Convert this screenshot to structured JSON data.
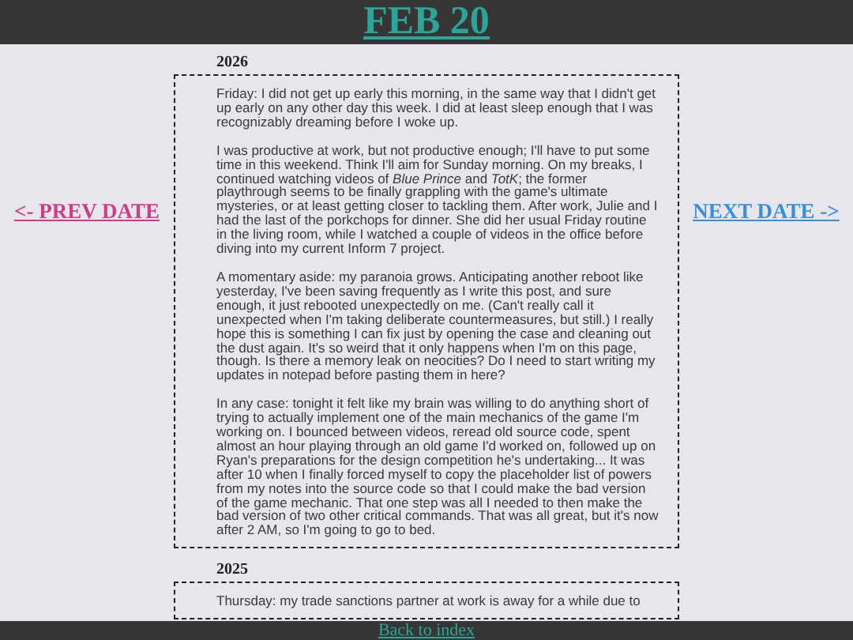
{
  "header": {
    "title": "FEB 20"
  },
  "nav": {
    "prev": "<- PREV DATE",
    "next": "NEXT DATE ->"
  },
  "entries": [
    {
      "year": "2026",
      "paragraphs": [
        "Friday: I did not get up early this morning, in the same way that I didn't get up early on any other day this week. I did at least sleep enough that I was recognizably dreaming before I woke up.",
        "I was productive at work, but not productive enough; I'll have to put some time in this weekend. Think I'll aim for Sunday morning. On my breaks, I continued watching videos of *Blue Prince* and *TotK*; the former playthrough seems to be finally grappling with the game's ultimate mysteries, or at least getting closer to tackling them. After work, Julie and I had the last of the porkchops for dinner. She did her usual Friday routine in the living room, while I watched a couple of videos in the office before diving into my current Inform 7 project.",
        "A momentary aside: my paranoia grows. Anticipating another reboot like yesterday, I've been saving frequently as I write this post, and sure enough, it just rebooted unexpectedly on me. (Can't really call it unexpected when I'm taking deliberate countermeasures, but still.) I really hope this is something I can fix just by opening the case and cleaning out the dust again. It's so weird that it only happens when I'm on this page, though. Is there a memory leak on neocities? Do I need to start writing my updates in notepad before pasting them in here?",
        "In any case: tonight it felt like my brain was willing to do anything short of trying to actually implement one of the main mechanics of the game I'm working on. I bounced between videos, reread old source code, spent almost an hour playing through an old game I'd worked on, followed up on Ryan's preparations for the design competition he's undertaking... It was after 10 when I finally forced myself to copy the placeholder list of powers from my notes into the source code so that I could make the bad version of the game mechanic. That one step was all I needed to then make the bad version of two other critical commands. That was all great, but it's now after 2 AM, so I'm going to go to bed."
      ]
    },
    {
      "year": "2025",
      "paragraphs": [
        "Thursday: my trade sanctions partner at work is away for a while due to"
      ]
    }
  ],
  "footer": {
    "link": "Back to index"
  }
}
